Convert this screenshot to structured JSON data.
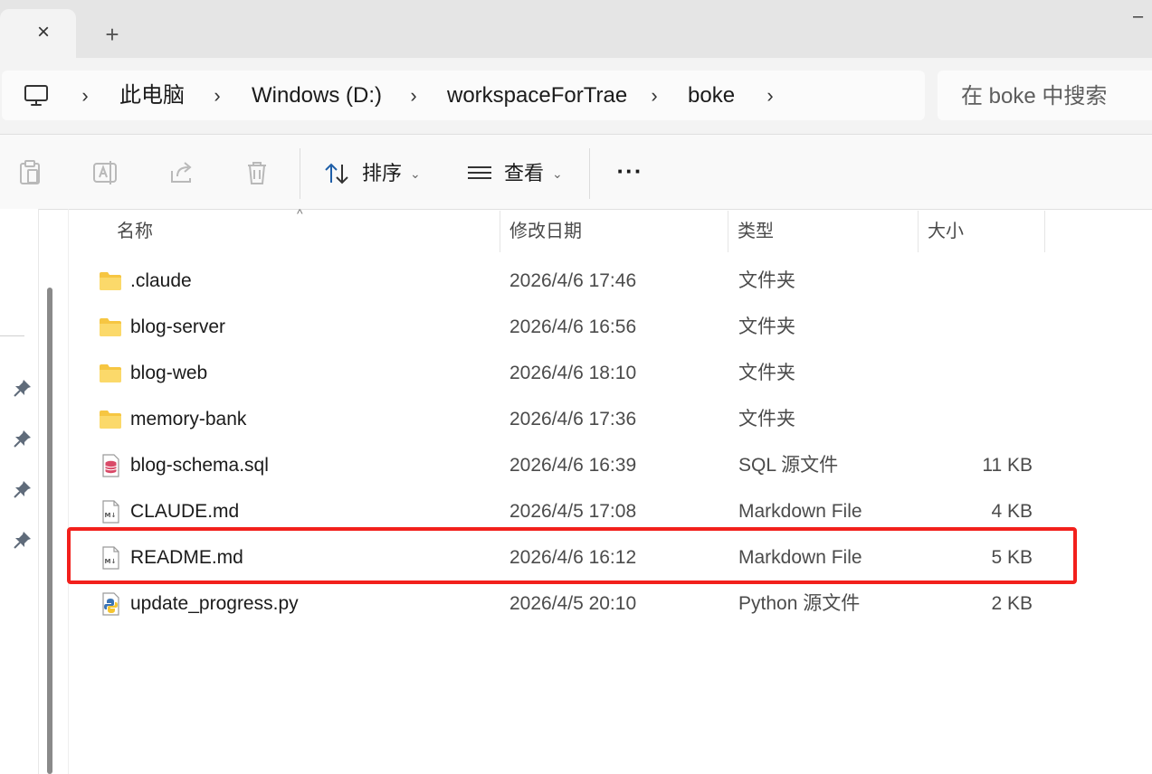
{
  "tab": {
    "close_label": "×",
    "new_tab_label": "+"
  },
  "window": {
    "minimize_label": "–"
  },
  "breadcrumb": {
    "items": [
      "此电脑",
      "Windows (D:)",
      "workspaceForTrae",
      "boke"
    ],
    "separator": "›"
  },
  "search": {
    "placeholder": "在 boke 中搜索"
  },
  "toolbar": {
    "sort_label": "排序",
    "view_label": "查看",
    "more_label": "···",
    "caret": "⌄"
  },
  "columns": {
    "name": "名称",
    "modified": "修改日期",
    "type": "类型",
    "size": "大小",
    "sort_indicator": "^"
  },
  "files": [
    {
      "name": ".claude",
      "modified": "2026/4/6 17:46",
      "type": "文件夹",
      "size": "",
      "icon": "folder-icon"
    },
    {
      "name": "blog-server",
      "modified": "2026/4/6 16:56",
      "type": "文件夹",
      "size": "",
      "icon": "folder-icon"
    },
    {
      "name": "blog-web",
      "modified": "2026/4/6 18:10",
      "type": "文件夹",
      "size": "",
      "icon": "folder-icon"
    },
    {
      "name": "memory-bank",
      "modified": "2026/4/6 17:36",
      "type": "文件夹",
      "size": "",
      "icon": "folder-icon"
    },
    {
      "name": "blog-schema.sql",
      "modified": "2026/4/6 16:39",
      "type": "SQL 源文件",
      "size": "11 KB",
      "icon": "sql-file-icon"
    },
    {
      "name": "CLAUDE.md",
      "modified": "2026/4/5 17:08",
      "type": "Markdown File",
      "size": "4 KB",
      "icon": "markdown-file-icon"
    },
    {
      "name": "README.md",
      "modified": "2026/4/6 16:12",
      "type": "Markdown File",
      "size": "5 KB",
      "icon": "markdown-file-icon"
    },
    {
      "name": "update_progress.py",
      "modified": "2026/4/5 20:10",
      "type": "Python 源文件",
      "size": "2 KB",
      "icon": "python-file-icon"
    }
  ],
  "colors": {
    "highlight": "#f2201c",
    "folder": "#f6c642",
    "sql": "#d94a68",
    "python_blue": "#3b74b5",
    "python_yellow": "#f5c531"
  }
}
